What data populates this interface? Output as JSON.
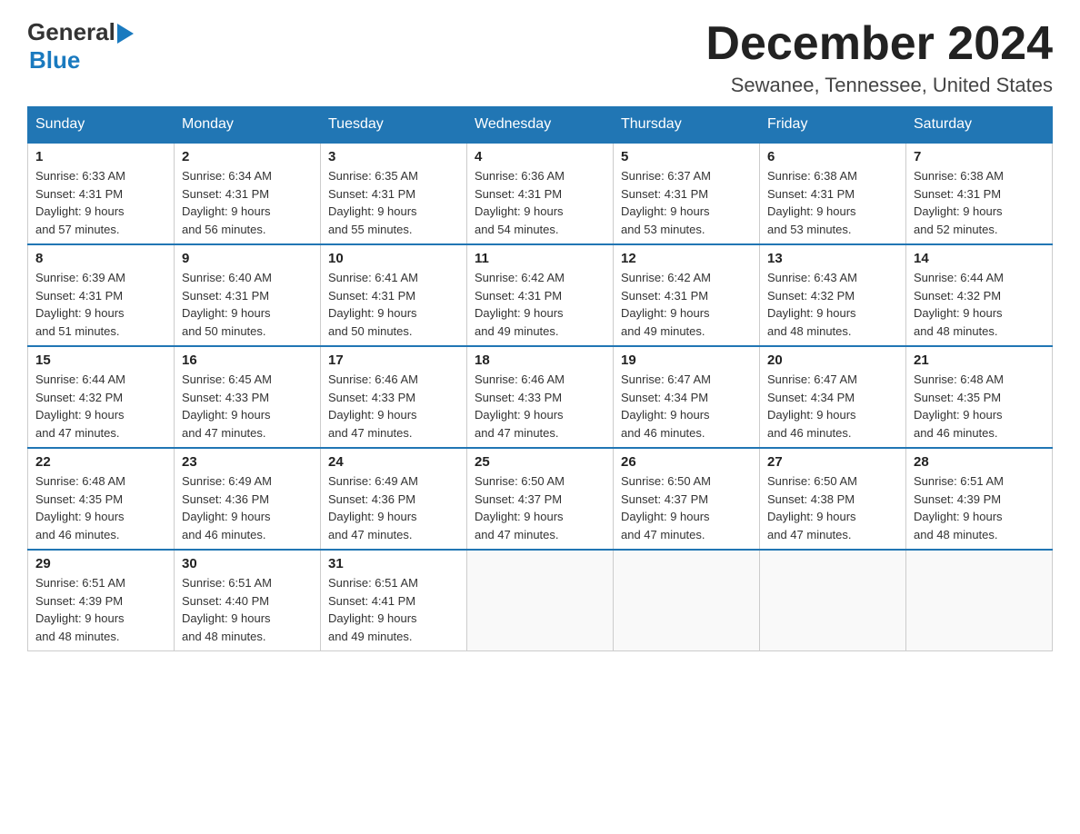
{
  "header": {
    "logo": {
      "text_general": "General",
      "text_blue": "Blue",
      "triangle": "▶"
    },
    "title": "December 2024",
    "location": "Sewanee, Tennessee, United States"
  },
  "weekdays": [
    "Sunday",
    "Monday",
    "Tuesday",
    "Wednesday",
    "Thursday",
    "Friday",
    "Saturday"
  ],
  "weeks": [
    [
      {
        "day": "1",
        "sunrise": "6:33 AM",
        "sunset": "4:31 PM",
        "daylight": "9 hours and 57 minutes."
      },
      {
        "day": "2",
        "sunrise": "6:34 AM",
        "sunset": "4:31 PM",
        "daylight": "9 hours and 56 minutes."
      },
      {
        "day": "3",
        "sunrise": "6:35 AM",
        "sunset": "4:31 PM",
        "daylight": "9 hours and 55 minutes."
      },
      {
        "day": "4",
        "sunrise": "6:36 AM",
        "sunset": "4:31 PM",
        "daylight": "9 hours and 54 minutes."
      },
      {
        "day": "5",
        "sunrise": "6:37 AM",
        "sunset": "4:31 PM",
        "daylight": "9 hours and 53 minutes."
      },
      {
        "day": "6",
        "sunrise": "6:38 AM",
        "sunset": "4:31 PM",
        "daylight": "9 hours and 53 minutes."
      },
      {
        "day": "7",
        "sunrise": "6:38 AM",
        "sunset": "4:31 PM",
        "daylight": "9 hours and 52 minutes."
      }
    ],
    [
      {
        "day": "8",
        "sunrise": "6:39 AM",
        "sunset": "4:31 PM",
        "daylight": "9 hours and 51 minutes."
      },
      {
        "day": "9",
        "sunrise": "6:40 AM",
        "sunset": "4:31 PM",
        "daylight": "9 hours and 50 minutes."
      },
      {
        "day": "10",
        "sunrise": "6:41 AM",
        "sunset": "4:31 PM",
        "daylight": "9 hours and 50 minutes."
      },
      {
        "day": "11",
        "sunrise": "6:42 AM",
        "sunset": "4:31 PM",
        "daylight": "9 hours and 49 minutes."
      },
      {
        "day": "12",
        "sunrise": "6:42 AM",
        "sunset": "4:31 PM",
        "daylight": "9 hours and 49 minutes."
      },
      {
        "day": "13",
        "sunrise": "6:43 AM",
        "sunset": "4:32 PM",
        "daylight": "9 hours and 48 minutes."
      },
      {
        "day": "14",
        "sunrise": "6:44 AM",
        "sunset": "4:32 PM",
        "daylight": "9 hours and 48 minutes."
      }
    ],
    [
      {
        "day": "15",
        "sunrise": "6:44 AM",
        "sunset": "4:32 PM",
        "daylight": "9 hours and 47 minutes."
      },
      {
        "day": "16",
        "sunrise": "6:45 AM",
        "sunset": "4:33 PM",
        "daylight": "9 hours and 47 minutes."
      },
      {
        "day": "17",
        "sunrise": "6:46 AM",
        "sunset": "4:33 PM",
        "daylight": "9 hours and 47 minutes."
      },
      {
        "day": "18",
        "sunrise": "6:46 AM",
        "sunset": "4:33 PM",
        "daylight": "9 hours and 47 minutes."
      },
      {
        "day": "19",
        "sunrise": "6:47 AM",
        "sunset": "4:34 PM",
        "daylight": "9 hours and 46 minutes."
      },
      {
        "day": "20",
        "sunrise": "6:47 AM",
        "sunset": "4:34 PM",
        "daylight": "9 hours and 46 minutes."
      },
      {
        "day": "21",
        "sunrise": "6:48 AM",
        "sunset": "4:35 PM",
        "daylight": "9 hours and 46 minutes."
      }
    ],
    [
      {
        "day": "22",
        "sunrise": "6:48 AM",
        "sunset": "4:35 PM",
        "daylight": "9 hours and 46 minutes."
      },
      {
        "day": "23",
        "sunrise": "6:49 AM",
        "sunset": "4:36 PM",
        "daylight": "9 hours and 46 minutes."
      },
      {
        "day": "24",
        "sunrise": "6:49 AM",
        "sunset": "4:36 PM",
        "daylight": "9 hours and 47 minutes."
      },
      {
        "day": "25",
        "sunrise": "6:50 AM",
        "sunset": "4:37 PM",
        "daylight": "9 hours and 47 minutes."
      },
      {
        "day": "26",
        "sunrise": "6:50 AM",
        "sunset": "4:37 PM",
        "daylight": "9 hours and 47 minutes."
      },
      {
        "day": "27",
        "sunrise": "6:50 AM",
        "sunset": "4:38 PM",
        "daylight": "9 hours and 47 minutes."
      },
      {
        "day": "28",
        "sunrise": "6:51 AM",
        "sunset": "4:39 PM",
        "daylight": "9 hours and 48 minutes."
      }
    ],
    [
      {
        "day": "29",
        "sunrise": "6:51 AM",
        "sunset": "4:39 PM",
        "daylight": "9 hours and 48 minutes."
      },
      {
        "day": "30",
        "sunrise": "6:51 AM",
        "sunset": "4:40 PM",
        "daylight": "9 hours and 48 minutes."
      },
      {
        "day": "31",
        "sunrise": "6:51 AM",
        "sunset": "4:41 PM",
        "daylight": "9 hours and 49 minutes."
      },
      null,
      null,
      null,
      null
    ]
  ],
  "labels": {
    "sunrise": "Sunrise:",
    "sunset": "Sunset:",
    "daylight": "Daylight:"
  }
}
